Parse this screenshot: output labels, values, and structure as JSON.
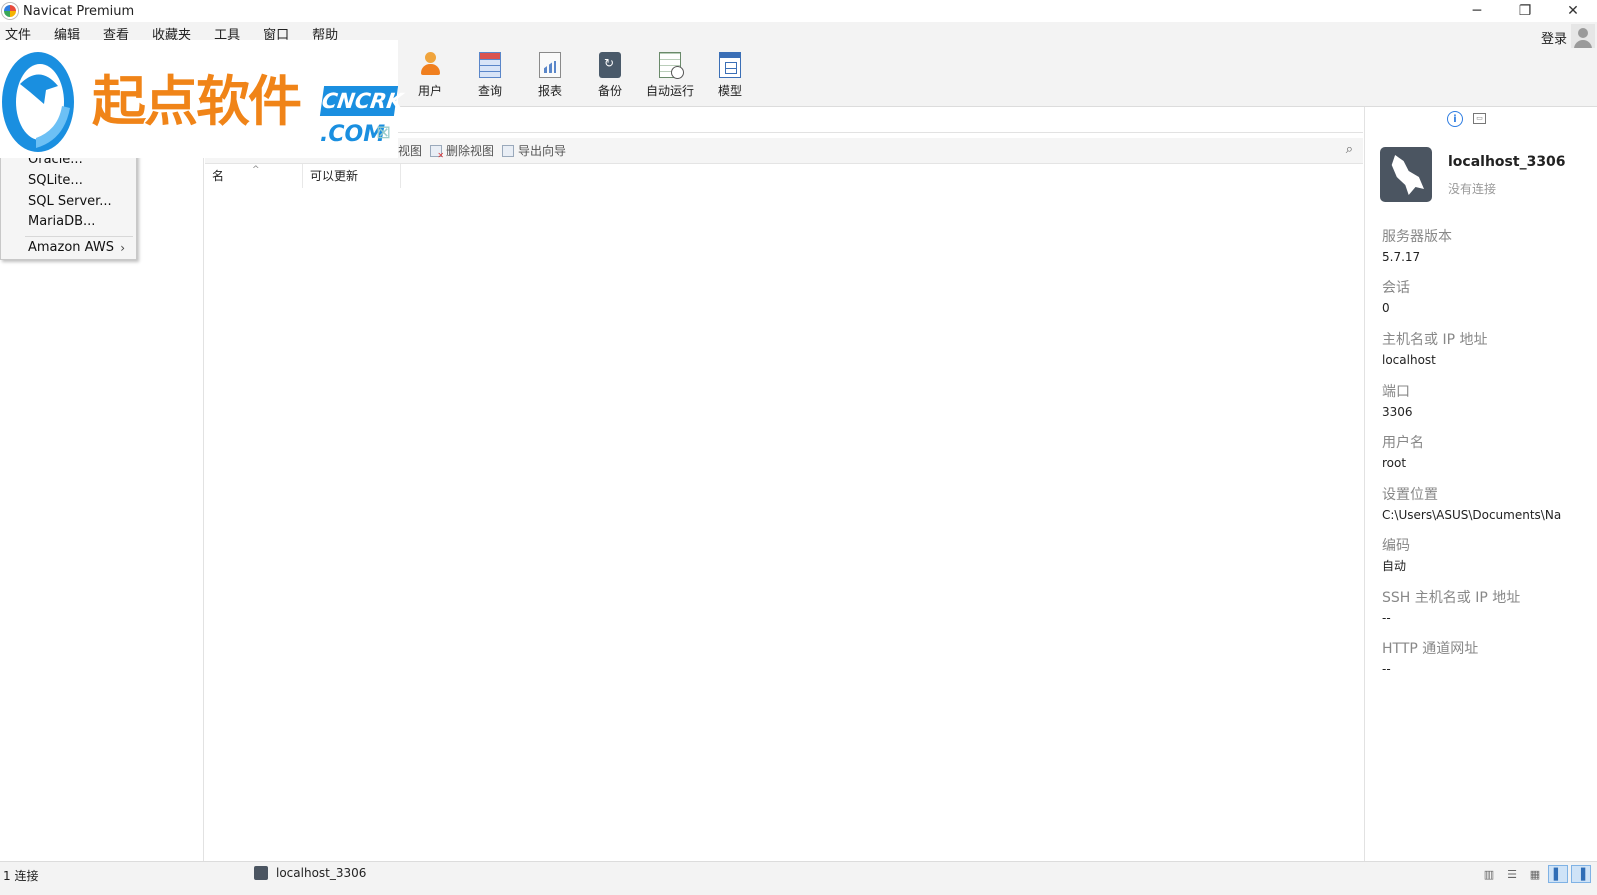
{
  "window": {
    "title": "Navicat Premium",
    "controls": {
      "minimize": "─",
      "restore": "❐",
      "close": "✕"
    }
  },
  "menu": [
    "文件",
    "编辑",
    "查看",
    "收藏夹",
    "工具",
    "窗口",
    "帮助"
  ],
  "account": {
    "login_label": "登录"
  },
  "toolbar": [
    {
      "label": "用户",
      "icon": "user-icon"
    },
    {
      "label": "查询",
      "icon": "query-icon"
    },
    {
      "label": "报表",
      "icon": "report-icon"
    },
    {
      "label": "备份",
      "icon": "backup-icon"
    },
    {
      "label": "自动运行",
      "icon": "automation-icon"
    },
    {
      "label": "模型",
      "icon": "model-icon"
    }
  ],
  "watermark": {
    "cn_text": "起点软件",
    "en_top": "CNCRK",
    "en_bottom": ".COM",
    "mark": "⊠"
  },
  "dropdown": {
    "items": [
      "Oracle...",
      "SQLite...",
      "SQL Server...",
      "MariaDB..."
    ],
    "submenu": {
      "label": "Amazon AWS",
      "arrow": "›"
    }
  },
  "object_toolbar": {
    "partial_label": "视图",
    "delete_view": "删除视图",
    "export_wizard": "导出向导",
    "search_icon": "⌕"
  },
  "table": {
    "columns": [
      "名",
      "可以更新"
    ],
    "sort_indicator": "^"
  },
  "info_panel": {
    "connection_name": "localhost_3306",
    "connection_status": "没有连接",
    "fields": [
      {
        "label": "服务器版本",
        "value": "5.7.17"
      },
      {
        "label": "会话",
        "value": "0"
      },
      {
        "label": "主机名或 IP 地址",
        "value": "localhost"
      },
      {
        "label": "端口",
        "value": "3306"
      },
      {
        "label": "用户名",
        "value": "root"
      },
      {
        "label": "设置位置",
        "value": "C:\\Users\\ASUS\\Documents\\Na"
      },
      {
        "label": "编码",
        "value": "自动"
      },
      {
        "label": "SSH 主机名或 IP 地址",
        "value": "--"
      },
      {
        "label": "HTTP 通道网址",
        "value": "--"
      }
    ]
  },
  "statusbar": {
    "connections": "1 连接",
    "current_connection": "localhost_3306"
  }
}
